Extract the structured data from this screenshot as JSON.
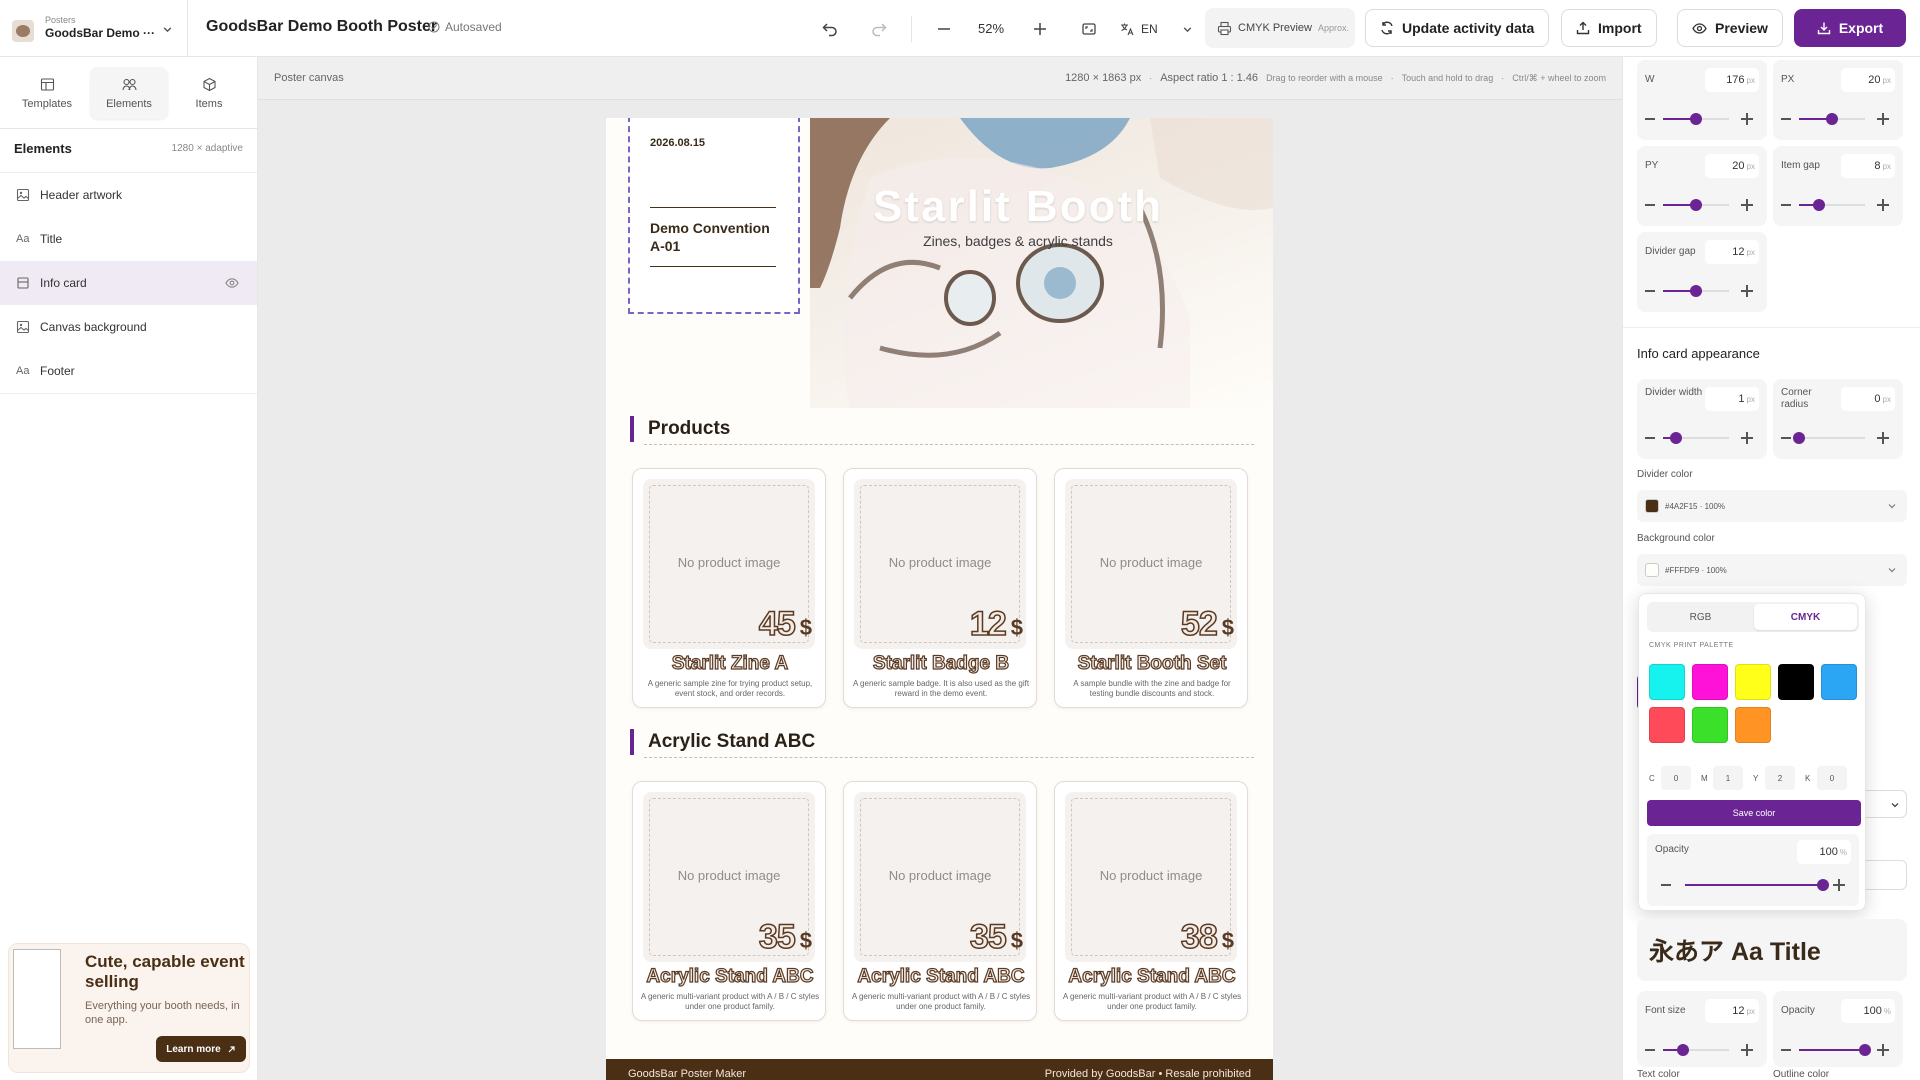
{
  "topbar": {
    "project_label": "Posters",
    "project_name": "GoodsBar Demo ···",
    "doc_title": "GoodsBar Demo Booth Poster",
    "autosaved": "Autosaved",
    "zoom": "52%",
    "lang": "EN",
    "cmyk_label": "CMYK Preview",
    "cmyk_approx": "Approx.",
    "update_label": "Update activity data",
    "import_label": "Import",
    "preview_label": "Preview",
    "export_label": "Export"
  },
  "left": {
    "tabs": [
      {
        "label": "Templates",
        "icon": "layout-icon"
      },
      {
        "label": "Elements",
        "icon": "shapes-icon"
      },
      {
        "label": "Items",
        "icon": "cube-icon"
      }
    ],
    "elements_title": "Elements",
    "elements_meta": "1280 × adaptive",
    "elements": [
      {
        "label": "Header artwork",
        "icon": "image-icon"
      },
      {
        "label": "Title",
        "icon": "text-icon"
      },
      {
        "label": "Info card",
        "icon": "card-icon"
      },
      {
        "label": "Canvas background",
        "icon": "image-icon"
      },
      {
        "label": "Footer",
        "icon": "text-icon"
      }
    ],
    "promo": {
      "title": "Cute, capable event selling",
      "subtitle": "Everything your booth needs, in one app.",
      "button": "Learn more"
    }
  },
  "canvas": {
    "label": "Poster canvas",
    "size": "1280 × 1863 px",
    "aspect": "Aspect ratio 1 : 1.46",
    "hint1": "Drag to reorder with a mouse",
    "hint2": "Touch and hold to drag",
    "hint3": "Ctrl/⌘ + wheel to zoom"
  },
  "poster": {
    "title": "Starlit Booth",
    "subtitle": "Zines, badges & acrylic stands",
    "info_date": "2026.08.15",
    "info_name": "Demo Convention A-01",
    "sections": [
      {
        "title": "Products",
        "items": [
          {
            "price": "45",
            "currency": "$",
            "name": "Starlit Zine A",
            "desc": "A generic sample zine for trying product setup, event stock, and order records.",
            "noimg": "No product image"
          },
          {
            "price": "12",
            "currency": "$",
            "name": "Starlit Badge B",
            "desc": "A generic sample badge. It is also used as the gift reward in the demo event.",
            "noimg": "No product image"
          },
          {
            "price": "52",
            "currency": "$",
            "name": "Starlit Booth Set",
            "desc": "A sample bundle with the zine and badge for testing bundle discounts and stock.",
            "noimg": "No product image"
          }
        ]
      },
      {
        "title": "Acrylic Stand ABC",
        "items": [
          {
            "price": "35",
            "currency": "$",
            "name": "Acrylic Stand ABC",
            "desc": "A generic multi-variant product with A / B / C styles under one product family.",
            "noimg": "No product image"
          },
          {
            "price": "35",
            "currency": "$",
            "name": "Acrylic Stand ABC",
            "desc": "A generic multi-variant product with A / B / C styles under one product family.",
            "noimg": "No product image"
          },
          {
            "price": "38",
            "currency": "$",
            "name": "Acrylic Stand ABC",
            "desc": "A generic multi-variant product with A / B / C styles under one product family.",
            "noimg": "No product image"
          }
        ]
      }
    ],
    "footer_left": "GoodsBar Poster Maker",
    "footer_right": "Provided by GoodsBar • Resale prohibited"
  },
  "right": {
    "controls": [
      {
        "label": "W",
        "value": "176",
        "unit": "px",
        "level": 0.5
      },
      {
        "label": "PX",
        "value": "20",
        "unit": "px",
        "level": 0.5
      },
      {
        "label": "PY",
        "value": "20",
        "unit": "px",
        "level": 0.5
      },
      {
        "label": "Item gap",
        "value": "8",
        "unit": "px",
        "level": 0.3
      },
      {
        "label": "Divider gap",
        "value": "12",
        "unit": "px",
        "level": 0.5
      }
    ],
    "appearance_title": "Info card appearance",
    "appearance_controls": [
      {
        "label": "Divider width",
        "value": "1",
        "unit": "px",
        "level": 0.2
      },
      {
        "label": "Corner radius",
        "value": "0",
        "unit": "px",
        "level": 0.0
      }
    ],
    "divider_color_label": "Divider color",
    "divider_color": "#4A2F15 · 100%",
    "divider_swatch": "#4a2f15",
    "bg_color_label": "Background color",
    "bg_color": "#FFFDF9 · 100%",
    "bg_swatch": "#fffdf9",
    "picker": {
      "tab_rgb": "RGB",
      "tab_cmyk": "CMYK",
      "palette_label": "CMYK PRINT PALETTE",
      "palette": [
        "#16f2ee",
        "#ff12d8",
        "#ffff1a",
        "#000000",
        "#2aa6f5",
        "#ff4a5a",
        "#3be02a",
        "#ff9424"
      ],
      "c": "0",
      "m": "1",
      "y": "2",
      "k": "0",
      "save": "Save color",
      "opacity_label": "Opacity",
      "opacity_value": "100",
      "opacity_unit": "%"
    },
    "font_preview": "永あア Aa Title",
    "font_size_label": "Font size",
    "font_size_value": "12",
    "font_opacity_label": "Opacity",
    "font_opacity_value": "100",
    "text_color_label": "Text color",
    "outline_color_label": "Outline color"
  },
  "colors": {
    "accent": "#6b2494",
    "brown": "#4a2f15"
  }
}
